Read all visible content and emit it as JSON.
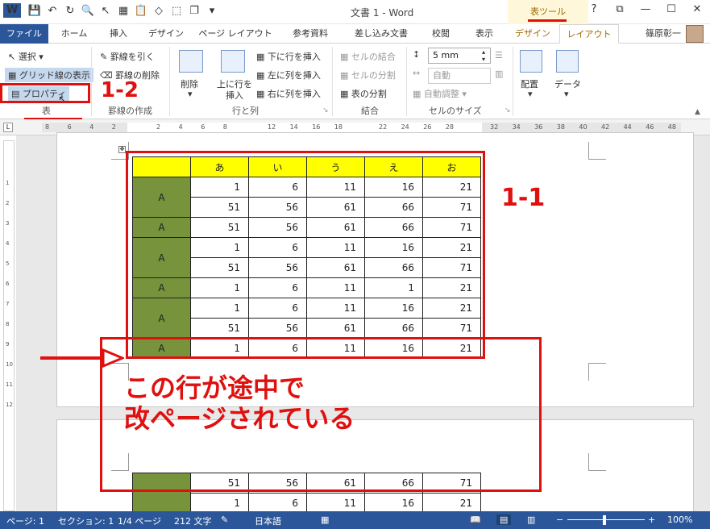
{
  "titlebar": {
    "title": "文書 1 - Word",
    "tool_tab": "表ツール",
    "help": "?",
    "restore_ribbon": "⧉",
    "minimize": "—",
    "maximize": "☐",
    "close": "✕"
  },
  "tabs": [
    {
      "label": "ファイル"
    },
    {
      "label": "ホーム"
    },
    {
      "label": "挿入"
    },
    {
      "label": "デザイン"
    },
    {
      "label": "ページ レイアウト"
    },
    {
      "label": "参考資料"
    },
    {
      "label": "差し込み文書"
    },
    {
      "label": "校閲"
    },
    {
      "label": "表示"
    },
    {
      "label": "デザイン"
    },
    {
      "label": "レイアウト"
    }
  ],
  "user": "篠原彰一",
  "ribbon": {
    "select": "選択",
    "gridlines": "グリッド線の表示",
    "properties": "プロパティ",
    "group_table": "表",
    "draw_table": "罫線を引く",
    "eraser": "罫線の削除",
    "group_draw": "罫線の作成",
    "delete": "削除",
    "insert_above_1": "上に行を",
    "insert_above_2": "挿入",
    "insert_below": "下に行を挿入",
    "insert_left": "左に列を挿入",
    "insert_right": "右に列を挿入",
    "group_rows_cols": "行と列",
    "merge_cells": "セルの結合",
    "split_cells": "セルの分割",
    "split_table": "表の分割",
    "group_merge": "結合",
    "height_value": "5 mm",
    "width_value": "自動",
    "autofit": "自動調整",
    "group_cell_size": "セルのサイズ",
    "alignment": "配置",
    "data": "データ"
  },
  "ruler": {
    "labels": [
      "8",
      "6",
      "4",
      "2",
      "",
      "2",
      "4",
      "6",
      "8",
      "",
      "12",
      "14",
      "16",
      "18",
      "",
      "22",
      "24",
      "26",
      "28",
      "",
      "32",
      "34",
      "36",
      "38",
      "40",
      "42",
      "44",
      "46",
      "48"
    ]
  },
  "vruler": {
    "labels": [
      "1",
      "2",
      "3",
      "4",
      "5",
      "6",
      "7",
      "8",
      "9",
      "10",
      "11",
      "12"
    ]
  },
  "table": {
    "headers": [
      "",
      "あ",
      "い",
      "う",
      "え",
      "お"
    ],
    "rows": [
      {
        "label": "A",
        "lines": [
          [
            "1",
            "6",
            "11",
            "16",
            "21"
          ],
          [
            "51",
            "56",
            "61",
            "66",
            "71"
          ]
        ]
      },
      {
        "label": "A",
        "lines": [
          [
            "51",
            "56",
            "61",
            "66",
            "71"
          ]
        ]
      },
      {
        "label": "A",
        "lines": [
          [
            "1",
            "6",
            "11",
            "16",
            "21"
          ],
          [
            "51",
            "56",
            "61",
            "66",
            "71"
          ]
        ]
      },
      {
        "label": "A",
        "lines": [
          [
            "1",
            "6",
            "11",
            "1",
            "21"
          ]
        ]
      },
      {
        "label": "A",
        "lines": [
          [
            "1",
            "6",
            "11",
            "16",
            "21"
          ],
          [
            "51",
            "56",
            "61",
            "66",
            "71"
          ]
        ]
      },
      {
        "label": "A",
        "lines": [
          [
            "1",
            "6",
            "11",
            "16",
            "21"
          ]
        ]
      }
    ],
    "continued": [
      [
        "51",
        "56",
        "61",
        "66",
        "71"
      ],
      [
        "1",
        "6",
        "11",
        "16",
        "21"
      ]
    ]
  },
  "annotations": {
    "step1": "1-1",
    "step2": "1-2",
    "callout_line1": "この行が途中で",
    "callout_line2": "改ページされている"
  },
  "statusbar": {
    "page": "ページ: 1",
    "section": "セクション: 1",
    "page_count": "1/4 ページ",
    "words": "212 文字",
    "language": "日本語",
    "zoom": "100%"
  }
}
